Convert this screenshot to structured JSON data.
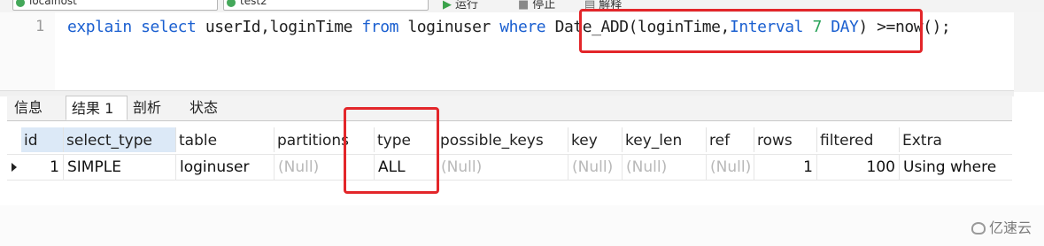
{
  "toolbar": {
    "connection_name": "localhost",
    "database_name": "test2",
    "run_label": "运行",
    "stop_label": "停止",
    "explain_label": "解释"
  },
  "editor": {
    "line_number": "1",
    "tokens": {
      "t1": "explain",
      "t2": "select",
      "t3": "userId,loginTime",
      "t4": "from",
      "t5": "loginuser",
      "t6": "where",
      "t7": "Date_ADD(loginTime,",
      "t8": "Interval",
      "t9": "7",
      "t10": "DAY",
      "t11": ")",
      "t12": ">=now();"
    }
  },
  "tabs": [
    "信息",
    "结果 1",
    "剖析",
    "状态"
  ],
  "active_tab": "结果 1",
  "grid": {
    "columns": [
      "id",
      "select_type",
      "table",
      "partitions",
      "type",
      "possible_keys",
      "key",
      "key_len",
      "ref",
      "rows",
      "filtered",
      "Extra"
    ],
    "row": [
      "1",
      "SIMPLE",
      "loginuser",
      "(Null)",
      "ALL",
      "(Null)",
      "(Null)",
      "(Null)",
      "(Null)",
      "1",
      "100",
      "Using where"
    ]
  },
  "colors": {
    "keyword": "#1a5fd0",
    "number": "#2aa35a",
    "highlight": "#e3262a",
    "null_text": "#b8b8b8"
  },
  "watermark": "亿速云"
}
